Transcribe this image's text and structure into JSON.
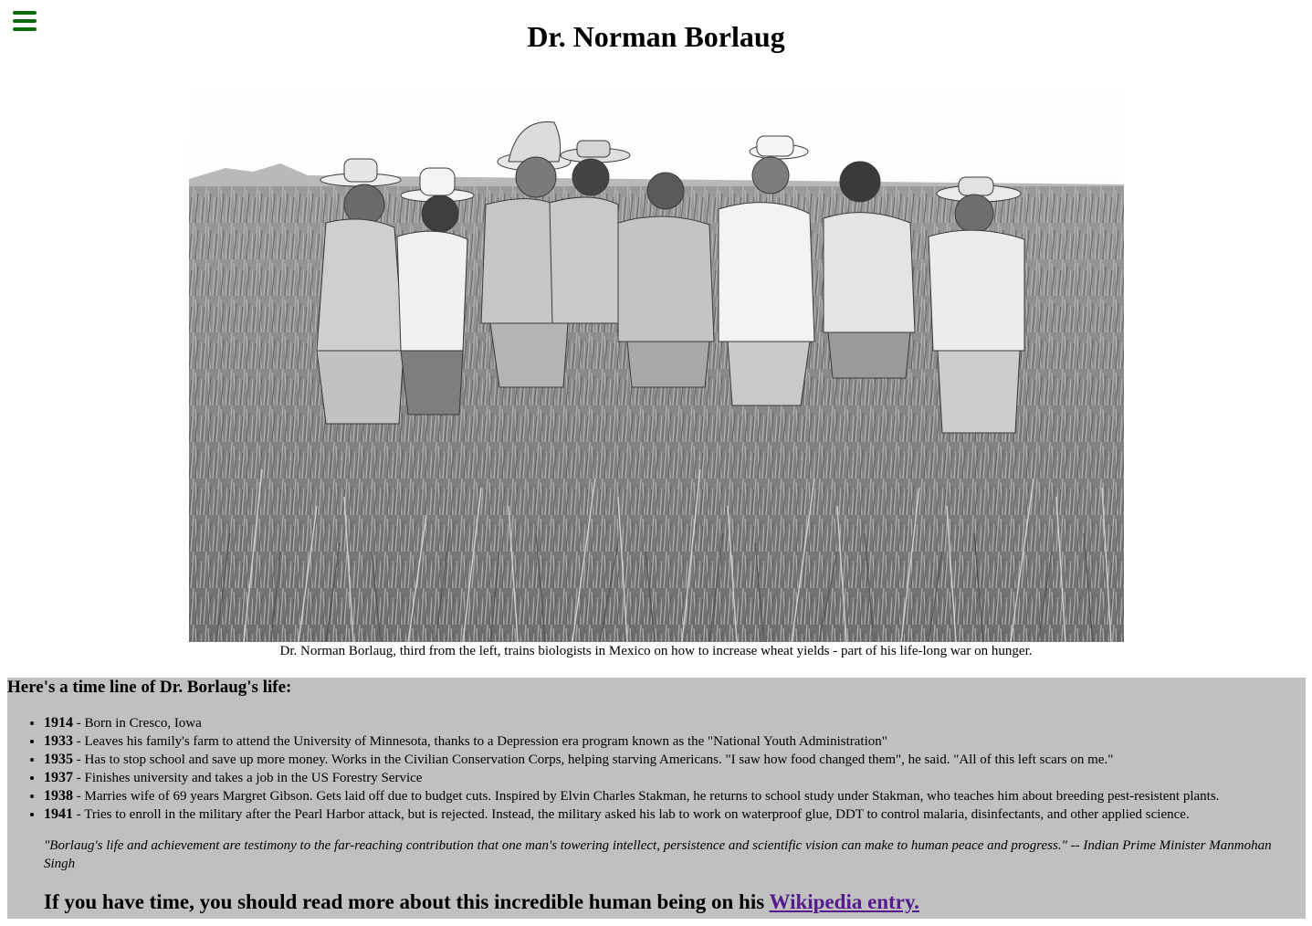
{
  "header": {
    "menu_icon": "hamburger-menu-icon",
    "title": "Dr. Norman Borlaug",
    "accent_color": "#0b6b0b"
  },
  "photo": {
    "caption": "Dr. Norman Borlaug, third from the left, trains biologists in Mexico on how to increase wheat yields - part of his life-long war on hunger."
  },
  "timeline": {
    "heading": "Here's a time line of Dr. Borlaug's life:",
    "background": "#c0c0c0",
    "items": [
      {
        "year": "1914",
        "text": " - Born in Cresco, Iowa"
      },
      {
        "year": "1933",
        "text": " - Leaves his family's farm to attend the University of Minnesota, thanks to a Depression era program known as the \"National Youth Administration\""
      },
      {
        "year": "1935",
        "text": " - Has to stop school and save up more money. Works in the Civilian Conservation Corps, helping starving Americans. \"I saw how food changed them\", he said. \"All of this left scars on me.\""
      },
      {
        "year": "1937",
        "text": " - Finishes university and takes a job in the US Forestry Service"
      },
      {
        "year": "1938",
        "text": " - Marries wife of 69 years Margret Gibson. Gets laid off due to budget cuts. Inspired by Elvin Charles Stakman, he returns to school study under Stakman, who teaches him about breeding pest-resistent plants."
      },
      {
        "year": "1941",
        "text": " - Tries to enroll in the military after the Pearl Harbor attack, but is rejected. Instead, the military asked his lab to work on waterproof glue, DDT to control malaria, disinfectants, and other applied science."
      }
    ],
    "quote": "\"Borlaug's life and achievement are testimony to the far-reaching contribution that one man's towering intellect, persistence and scientific vision can make to human peace and progress.\" -- Indian Prime Minister Manmohan Singh",
    "more_text": "If you have time, you should read more about this incredible human being on his ",
    "link_text": "Wikipedia entry.",
    "link_color": "#551a8b"
  }
}
